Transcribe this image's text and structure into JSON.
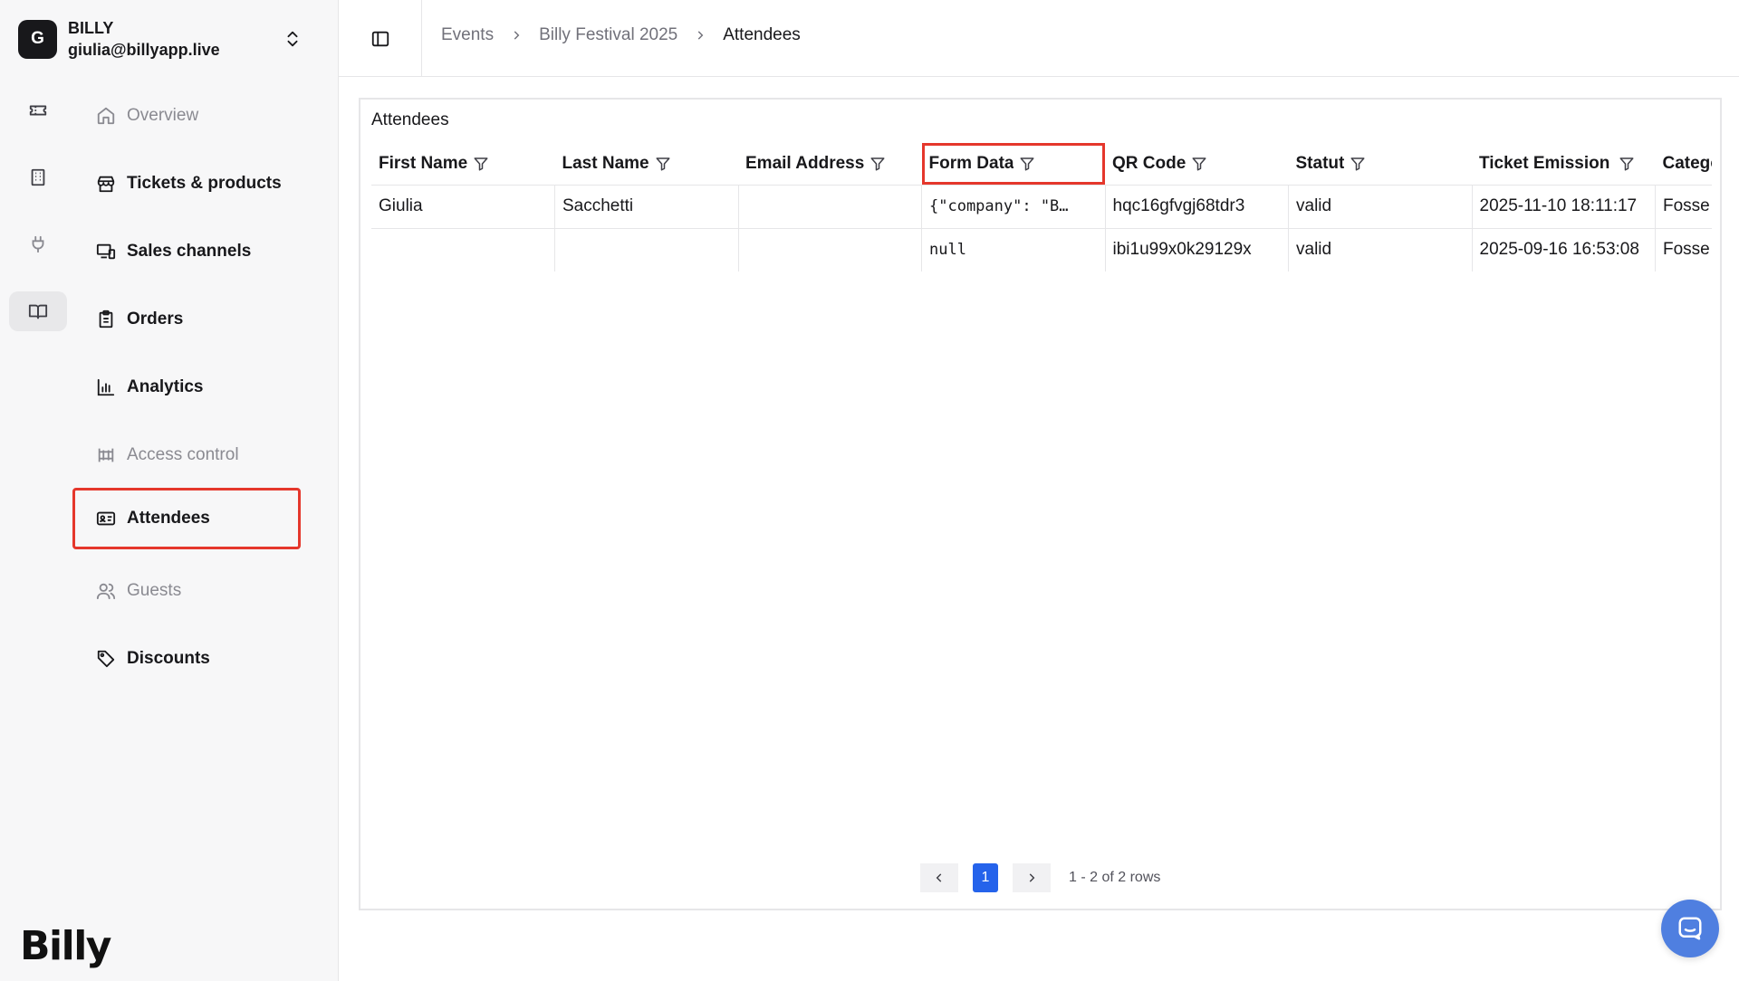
{
  "account": {
    "initial": "G",
    "name": "BILLY",
    "email": "giulia@billyapp.live"
  },
  "rail": [
    "ticket-icon",
    "building-icon",
    "plug-icon",
    "book-icon"
  ],
  "nav": {
    "overview": "Overview",
    "tickets": "Tickets & products",
    "sales_channels": "Sales channels",
    "orders": "Orders",
    "analytics": "Analytics",
    "access_control": "Access control",
    "attendees": "Attendees",
    "guests": "Guests",
    "discounts": "Discounts"
  },
  "brand": "Billy",
  "breadcrumb": {
    "events": "Events",
    "event": "Billy Festival 2025",
    "current": "Attendees"
  },
  "panel": {
    "title": "Attendees"
  },
  "table": {
    "columns": [
      "First Name",
      "Last Name",
      "Email Address",
      "Form Data",
      "QR Code",
      "Statut",
      "Ticket Emission D",
      "Categor"
    ],
    "rows": [
      [
        "Giulia",
        "Sacchetti",
        "",
        "{\"company\": \"B…",
        "hqc16gfvgj68tdr3",
        "valid",
        "2025-11-10 18:11:17",
        "Fosse"
      ],
      [
        "",
        "",
        "",
        "null",
        "ibi1u99x0k29129x",
        "valid",
        "2025-09-16 16:53:08",
        "Fosse"
      ]
    ]
  },
  "pagination": {
    "page": "1",
    "summary": "1 - 2 of 2 rows"
  },
  "colors": {
    "highlight": "#e5372c",
    "accent": "#2563eb",
    "chat": "#4f7fe0"
  }
}
